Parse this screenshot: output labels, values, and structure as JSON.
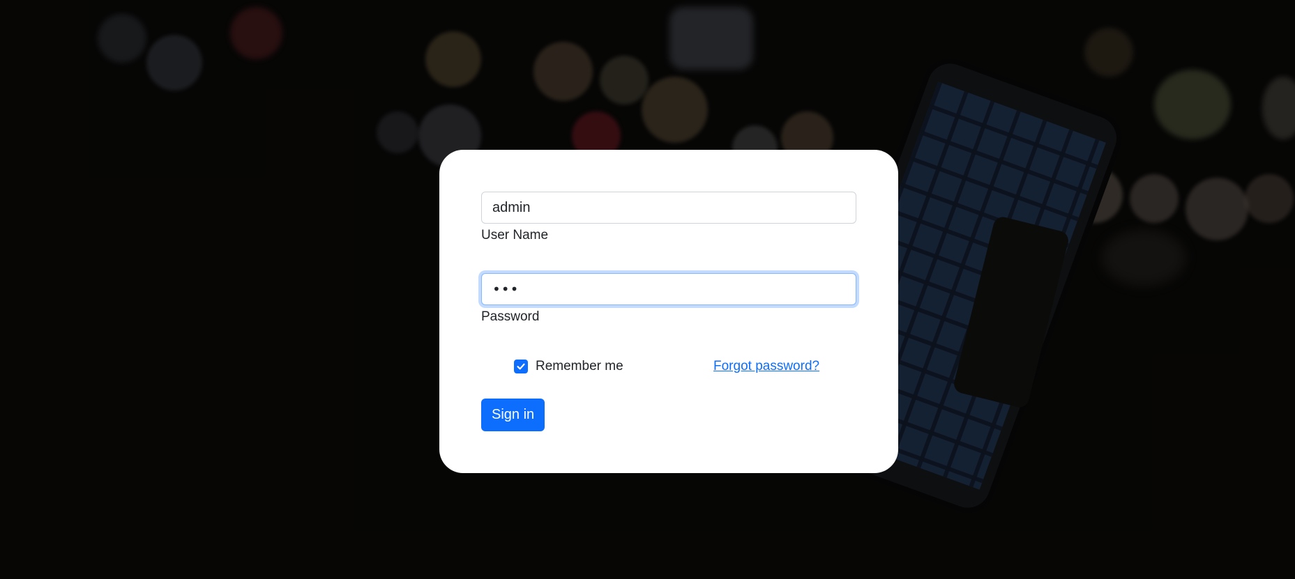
{
  "login": {
    "username_value": "admin",
    "username_label": "User Name",
    "password_value": "•••",
    "password_label": "Password",
    "remember_label": "Remember me",
    "remember_checked": true,
    "forgot_label": "Forgot password?",
    "signin_label": "Sign in"
  },
  "colors": {
    "primary": "#0d6efd",
    "card": "#ffffff",
    "focus_ring": "#86b7fe"
  }
}
